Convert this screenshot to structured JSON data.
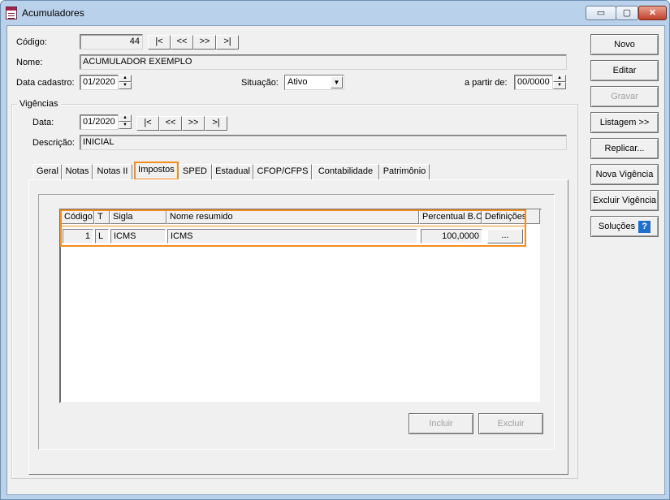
{
  "window": {
    "title": "Acumuladores",
    "min_label": "▭",
    "max_label": "▢",
    "close_label": "✕"
  },
  "form": {
    "codigo_label": "Código:",
    "codigo_value": "44",
    "nav": [
      "|<",
      "<<",
      ">>",
      ">|"
    ],
    "nome_label": "Nome:",
    "nome_value": "ACUMULADOR EXEMPLO",
    "data_cadastro_label": "Data cadastro:",
    "data_cadastro_value": "01/2020",
    "situacao_label": "Situação:",
    "situacao_value": "Ativo",
    "a_partir_label": "a partir de:",
    "a_partir_value": "00/0000"
  },
  "vigencias": {
    "group_label": "Vigências",
    "data_label": "Data:",
    "data_value": "01/2020",
    "nav": [
      "|<",
      "<<",
      ">>",
      ">|"
    ],
    "descricao_label": "Descrição:",
    "descricao_value": "INICIAL"
  },
  "tabs": [
    {
      "label": "Geral"
    },
    {
      "label": "Notas"
    },
    {
      "label": "Notas II"
    },
    {
      "label": "Impostos"
    },
    {
      "label": "SPED"
    },
    {
      "label": "Estadual"
    },
    {
      "label": "CFOP/CFPS"
    },
    {
      "label": "Contabilidade"
    },
    {
      "label": "Patrimônio"
    }
  ],
  "grid": {
    "headers": [
      "Código",
      "T",
      "Sigla",
      "Nome resumido",
      "Percentual B.C.",
      "Definições"
    ],
    "rows": [
      {
        "codigo": "1",
        "t": "L",
        "sigla": "ICMS",
        "nome": "ICMS",
        "percentual": "100,0000",
        "definicoes": "..."
      }
    ]
  },
  "buttons": {
    "incluir": "Incluir",
    "excluir": "Excluir"
  },
  "side_buttons": [
    "Novo",
    "Editar",
    "Gravar",
    "Listagem >>",
    "Replicar...",
    "Nova Vigência",
    "Excluir Vigência",
    "Soluções"
  ],
  "help_glyph": "?",
  "highlight_color": "#f28c1e"
}
